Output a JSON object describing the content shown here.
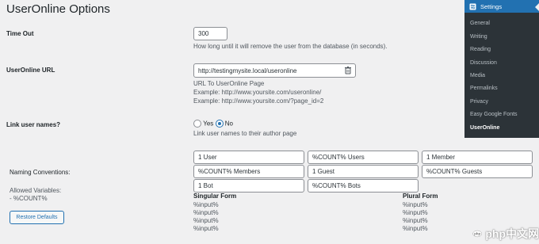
{
  "page": {
    "title": "UserOnline Options"
  },
  "timeout": {
    "label": "Time Out",
    "value": "300",
    "description": "How long until it will remove the user from the database (in seconds)."
  },
  "url": {
    "label": "UserOnline URL",
    "value": "http://testingmysite.local/useronline",
    "description_lines": [
      "URL To UserOnline Page",
      "Example: http://www.yoursite.com/useronline/",
      "Example: http://www.yoursite.com/?page_id=2"
    ]
  },
  "link_names": {
    "label": "Link user names?",
    "options": [
      "Yes",
      "No"
    ],
    "selected": "No",
    "description": "Link user names to their author page"
  },
  "naming": {
    "label": "Naming Conventions:",
    "fields": [
      [
        "1 User",
        "%COUNT% Users",
        "1 Member"
      ],
      [
        "%COUNT% Members",
        "1 Guest",
        "%COUNT% Guests"
      ],
      [
        "1 Bot",
        "%COUNT% Bots"
      ]
    ],
    "allowed_label": "Allowed Variables:",
    "allowed_value": "- %COUNT%",
    "restore_button": "Restore Defaults"
  },
  "forms": {
    "singular_heading": "Singular Form",
    "plural_heading": "Plural Form",
    "singular_items": [
      "%input%",
      "%input%",
      "%input%",
      "%input%"
    ],
    "plural_items": [
      "%input%",
      "%input%",
      "%input%",
      "%input%"
    ]
  },
  "sidebar": {
    "header": "Settings",
    "items": [
      "General",
      "Writing",
      "Reading",
      "Discussion",
      "Media",
      "Permalinks",
      "Privacy",
      "Easy Google Fonts",
      "UserOnline"
    ],
    "current": "UserOnline"
  },
  "watermark": {
    "text": "php中文网"
  },
  "colors": {
    "accent": "#2271b1",
    "sidebar_bg": "#2c3338",
    "page_bg": "#f0f0f1"
  }
}
